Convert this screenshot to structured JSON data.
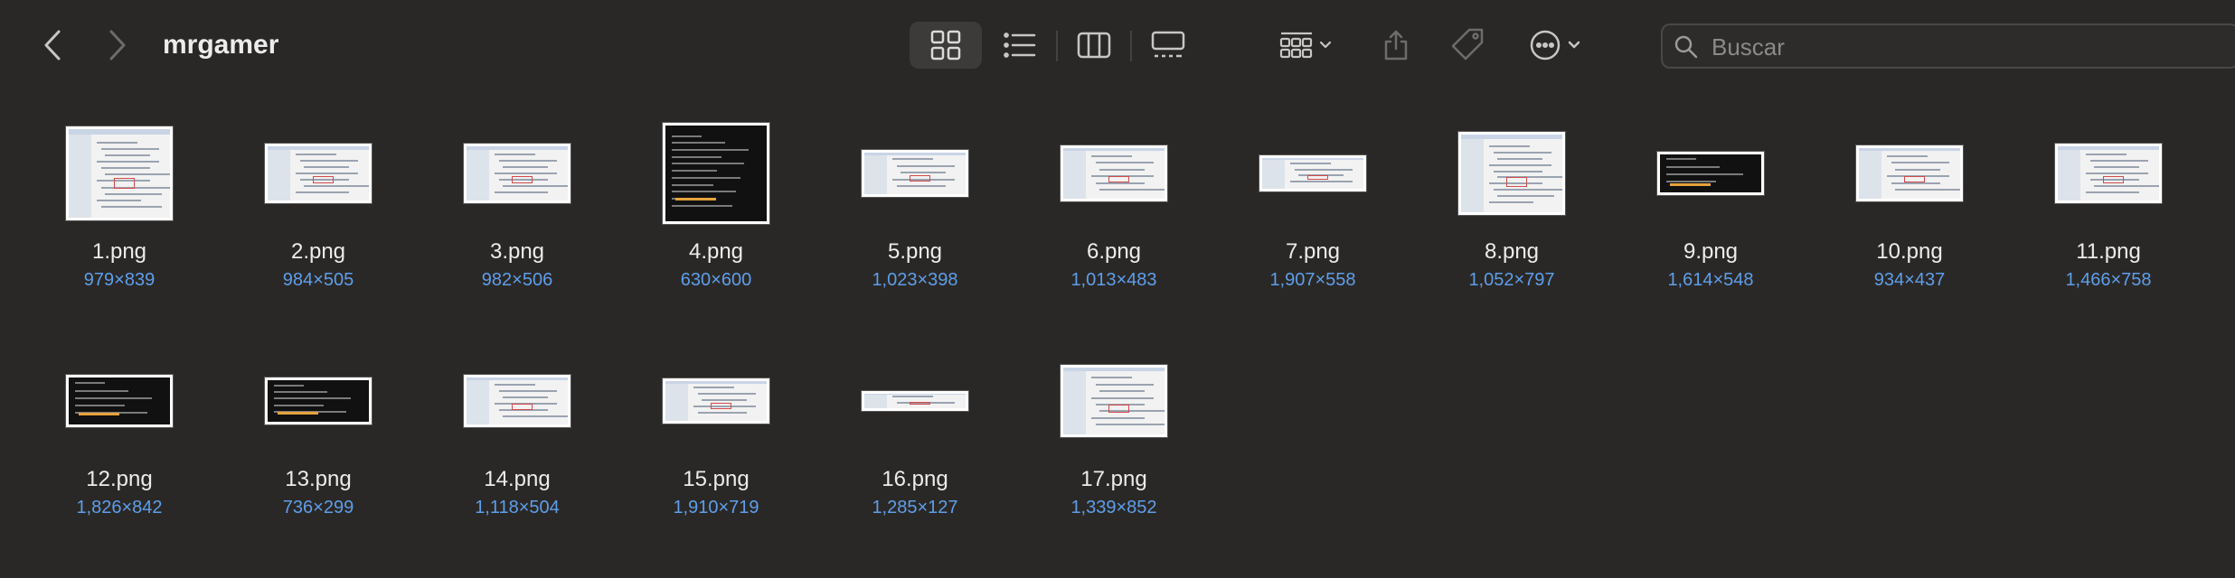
{
  "toolbar": {
    "title": "mrgamer",
    "search_placeholder": "Buscar",
    "icons": {
      "back": "chevron-left",
      "forward": "chevron-right",
      "view_icons": "grid-four-squares",
      "view_list": "bulleted-list",
      "view_columns": "three-columns",
      "view_gallery": "gallery",
      "group": "grid-dropdown",
      "share": "share-up-arrow",
      "tags": "tag",
      "more": "ellipsis-circle",
      "search": "magnifying-glass"
    }
  },
  "files": [
    {
      "name": "1.png",
      "dims": "979×839"
    },
    {
      "name": "2.png",
      "dims": "984×505"
    },
    {
      "name": "3.png",
      "dims": "982×506"
    },
    {
      "name": "4.png",
      "dims": "630×600"
    },
    {
      "name": "5.png",
      "dims": "1,023×398"
    },
    {
      "name": "6.png",
      "dims": "1,013×483"
    },
    {
      "name": "7.png",
      "dims": "1,907×558"
    },
    {
      "name": "8.png",
      "dims": "1,052×797"
    },
    {
      "name": "9.png",
      "dims": "1,614×548"
    },
    {
      "name": "10.png",
      "dims": "934×437"
    },
    {
      "name": "11.png",
      "dims": "1,466×758"
    },
    {
      "name": "12.png",
      "dims": "1,826×842"
    },
    {
      "name": "13.png",
      "dims": "736×299"
    },
    {
      "name": "14.png",
      "dims": "1,118×504"
    },
    {
      "name": "15.png",
      "dims": "1,910×719"
    },
    {
      "name": "16.png",
      "dims": "1,285×127"
    },
    {
      "name": "17.png",
      "dims": "1,339×852"
    }
  ],
  "colors": {
    "background": "#2a2826",
    "text": "#ececec",
    "dimension_text": "#5e9eea",
    "selected_view_bg": "#3d3b39"
  }
}
